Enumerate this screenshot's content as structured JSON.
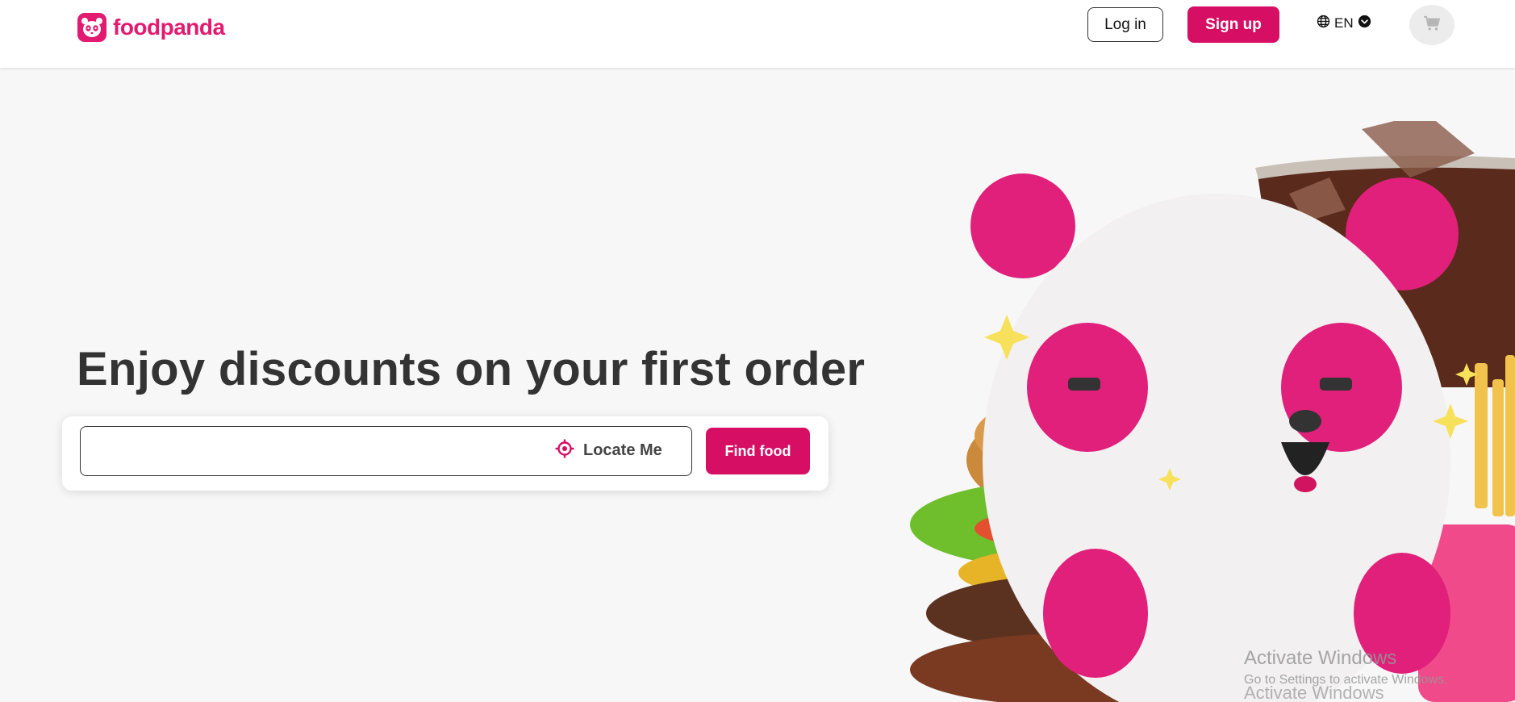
{
  "header": {
    "brand": "foodpanda",
    "login_label": "Log in",
    "signup_label": "Sign up",
    "language": "EN"
  },
  "hero": {
    "title": "Enjoy discounts on your first order",
    "search_value": "",
    "locate_label": "Locate Me",
    "find_label": "Find food"
  },
  "watermark": {
    "title": "Activate Windows",
    "subtitle": "Go to Settings to activate Windows.",
    "ghost": "Activate Windows"
  },
  "colors": {
    "brand_pink": "#d70f64",
    "logo_pink": "#e21b70",
    "background": "#f7f7f7"
  },
  "icons": [
    "panda-logo-icon",
    "globe-icon",
    "chevron-down-icon",
    "cart-icon",
    "locate-crosshair-icon"
  ]
}
